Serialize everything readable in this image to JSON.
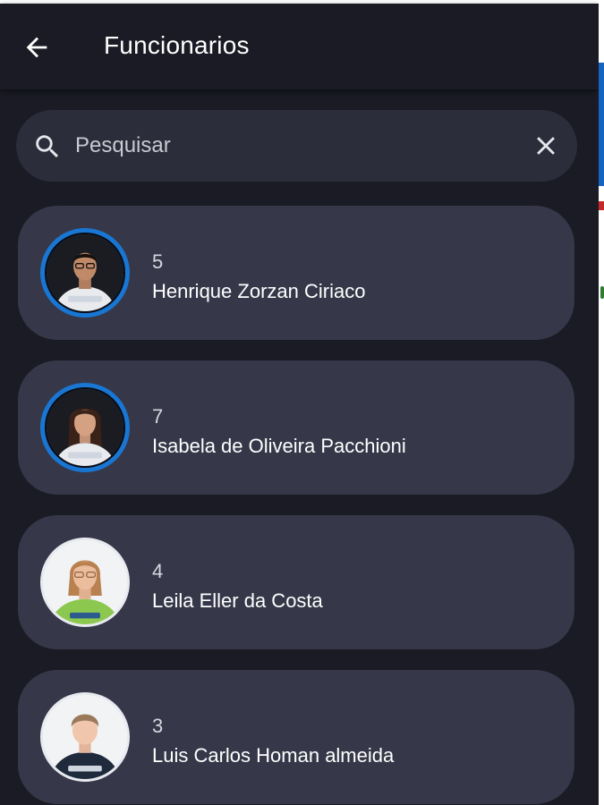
{
  "header": {
    "title": "Funcionarios",
    "back_icon": "arrow-left-icon"
  },
  "search": {
    "placeholder": "Pesquisar",
    "value": "",
    "search_icon": "search-icon",
    "clear_icon": "close-icon"
  },
  "employees": [
    {
      "id": "5",
      "name": "Henrique Zorzan Ciriaco",
      "avatar_style": "blue-ring"
    },
    {
      "id": "7",
      "name": "Isabela de Oliveira Pacchioni",
      "avatar_style": "blue-ring"
    },
    {
      "id": "4",
      "name": "Leila Eller da Costa",
      "avatar_style": "light-ring"
    },
    {
      "id": "3",
      "name": "Luis Carlos Homan almeida",
      "avatar_style": "light-ring"
    }
  ],
  "colors": {
    "background": "#1a1b24",
    "card": "#363849",
    "search_bar": "#2b2d3a",
    "accent": "#1976d2",
    "text": "#ffffff"
  }
}
